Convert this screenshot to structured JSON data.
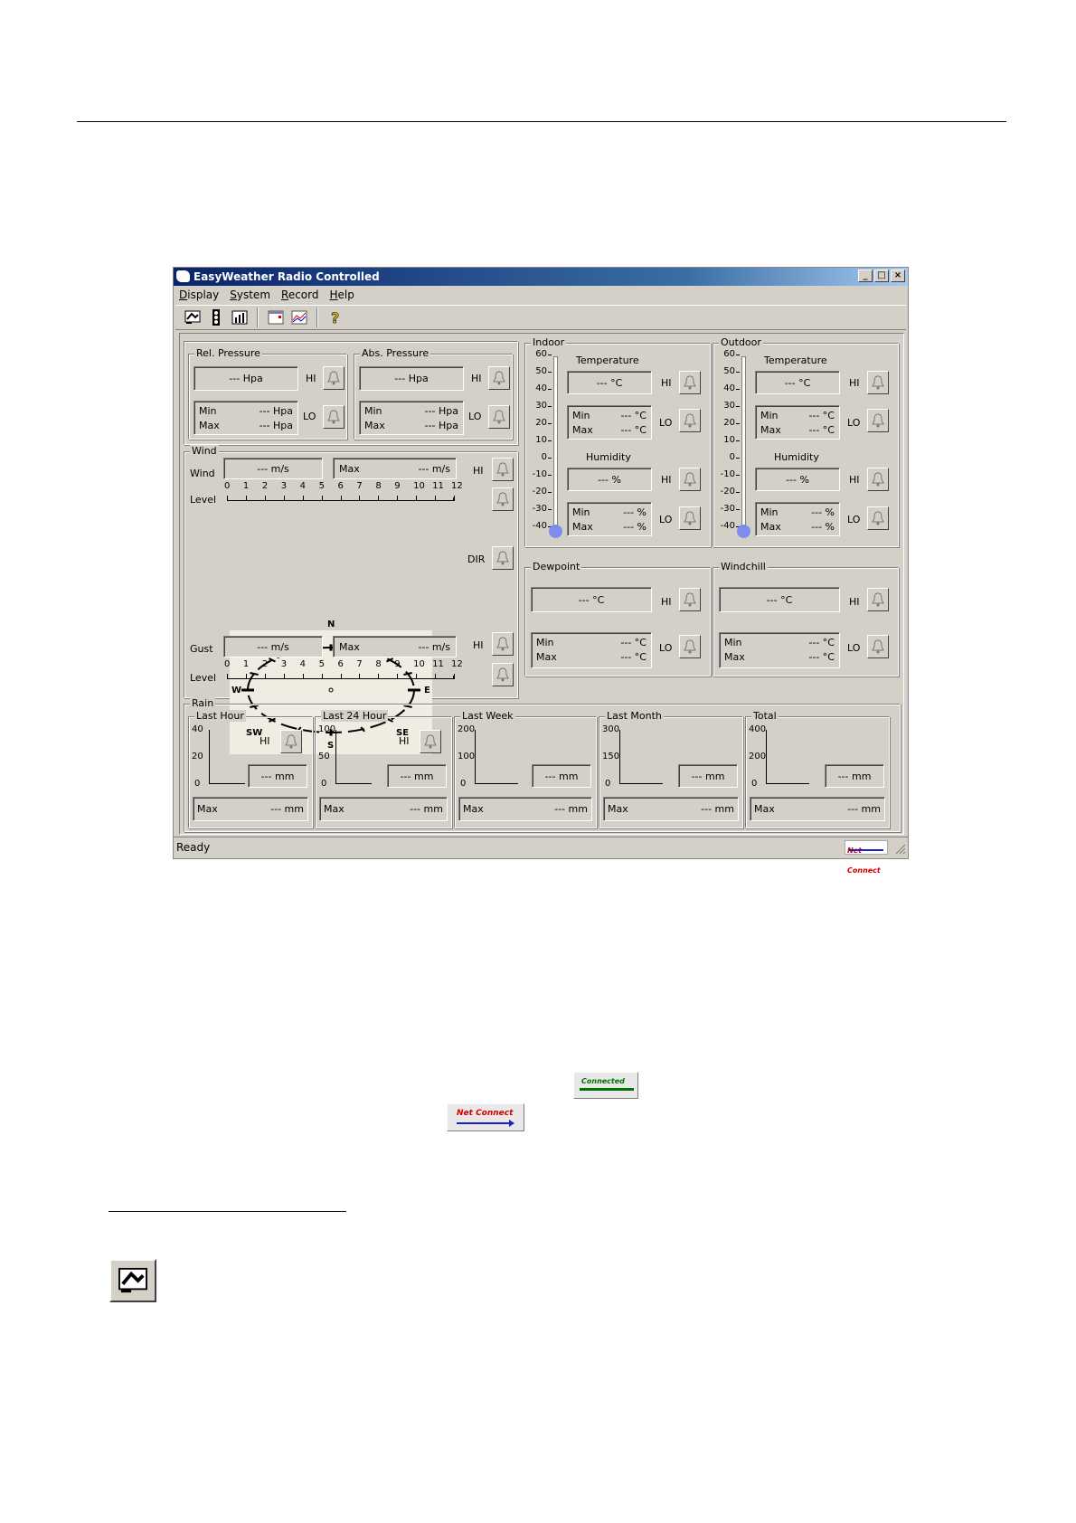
{
  "window": {
    "title": "EasyWeather Radio Controlled",
    "controls": [
      "_",
      "□",
      "×"
    ],
    "menu": [
      "Display",
      "System",
      "Record",
      "Help"
    ],
    "status": "Ready",
    "net_badge": "Net Connect"
  },
  "toolbar": {
    "icons": [
      "display-icon",
      "traffic-light-icon",
      "chart-icon",
      "calendar-icon",
      "graph-icon",
      "help-icon"
    ]
  },
  "pressure": {
    "rel": {
      "title": "Rel. Pressure",
      "value": "--- Hpa",
      "min_label": "Min",
      "min": "--- Hpa",
      "max_label": "Max",
      "max": "--- Hpa",
      "hi": "HI",
      "lo": "LO"
    },
    "abs": {
      "title": "Abs. Pressure",
      "value": "--- Hpa",
      "min_label": "Min",
      "min": "--- Hpa",
      "max_label": "Max",
      "max": "--- Hpa",
      "hi": "HI",
      "lo": "LO"
    }
  },
  "wind": {
    "title": "Wind",
    "wind_label": "Wind",
    "wind_value": "--- m/s",
    "max_label": "Max",
    "max_value": "--- m/s",
    "level_label": "Level",
    "levels": [
      "0",
      "1",
      "2",
      "3",
      "4",
      "5",
      "6",
      "7",
      "8",
      "9",
      "10",
      "11",
      "12"
    ],
    "hi": "HI",
    "dir": "DIR",
    "compass": {
      "N": "N",
      "NE": "NE",
      "E": "E",
      "SE": "SE",
      "S": "S",
      "SW": "SW",
      "W": "W",
      "NW": "NW"
    },
    "gust_label": "Gust",
    "gust_value": "--- m/s",
    "gust_max_label": "Max",
    "gust_max_value": "--- m/s",
    "gust_level_label": "Level"
  },
  "indoor": {
    "title": "Indoor",
    "scale": [
      "60",
      "50",
      "40",
      "30",
      "20",
      "10",
      "0",
      "-10",
      "-20",
      "-30",
      "-40"
    ],
    "temp_title": "Temperature",
    "temp_value": "--- °C",
    "temp_min_label": "Min",
    "temp_min": "--- °C",
    "temp_max_label": "Max",
    "temp_max": "--- °C",
    "hum_title": "Humidity",
    "hum_value": "--- %",
    "hum_min_label": "Min",
    "hum_min": "--- %",
    "hum_max_label": "Max",
    "hum_max": "--- %",
    "hi": "HI",
    "lo": "LO"
  },
  "outdoor": {
    "title": "Outdoor",
    "scale": [
      "60",
      "50",
      "40",
      "30",
      "20",
      "10",
      "0",
      "-10",
      "-20",
      "-30",
      "-40"
    ],
    "temp_title": "Temperature",
    "temp_value": "--- °C",
    "temp_min_label": "Min",
    "temp_min": "--- °C",
    "temp_max_label": "Max",
    "temp_max": "--- °C",
    "hum_title": "Humidity",
    "hum_value": "--- %",
    "hum_min_label": "Min",
    "hum_min": "--- %",
    "hum_max_label": "Max",
    "hum_max": "--- %",
    "hi": "HI",
    "lo": "LO"
  },
  "dewpoint": {
    "title": "Dewpoint",
    "value": "--- °C",
    "min_label": "Min",
    "min": "--- °C",
    "max_label": "Max",
    "max": "--- °C",
    "hi": "HI",
    "lo": "LO"
  },
  "windchill": {
    "title": "Windchill",
    "value": "--- °C",
    "min_label": "Min",
    "min": "--- °C",
    "max_label": "Max",
    "max": "--- °C",
    "hi": "HI",
    "lo": "LO"
  },
  "rain": {
    "title": "Rain",
    "hi": "HI",
    "periods": [
      {
        "title": "Last Hour",
        "ticks": [
          "40",
          "20",
          "0"
        ],
        "value": "--- mm",
        "max_label": "Max",
        "max": "--- mm"
      },
      {
        "title": "Last 24 Hour",
        "ticks": [
          "100",
          "50",
          "0"
        ],
        "value": "--- mm",
        "max_label": "Max",
        "max": "--- mm"
      },
      {
        "title": "Last Week",
        "ticks": [
          "200",
          "100",
          "0"
        ],
        "value": "--- mm",
        "max_label": "Max",
        "max": "--- mm"
      },
      {
        "title": "Last Month",
        "ticks": [
          "300",
          "150",
          "0"
        ],
        "value": "--- mm",
        "max_label": "Max",
        "max": "--- mm"
      },
      {
        "title": "Total",
        "ticks": [
          "400",
          "200",
          "0"
        ],
        "value": "--- mm",
        "max_label": "Max",
        "max": "--- mm"
      }
    ]
  },
  "doc": {
    "connected_badge": "Connected",
    "net_badge": "Net Connect",
    "icon": "display-icon"
  }
}
